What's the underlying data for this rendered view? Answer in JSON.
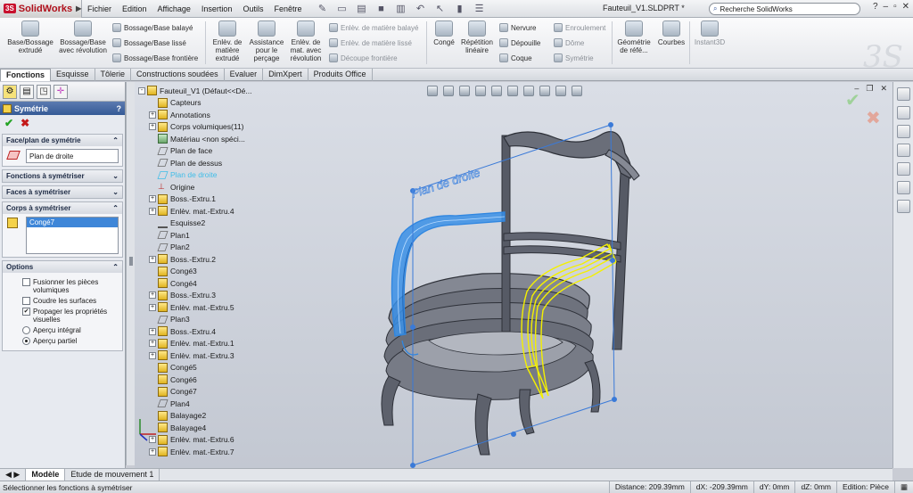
{
  "app": {
    "logo_prefix": "3S",
    "logo_name": "SolidWorks",
    "doc_title": "Fauteuil_V1.SLDPRT *",
    "search_placeholder": "Recherche SolidWorks"
  },
  "menu": [
    "Fichier",
    "Edition",
    "Affichage",
    "Insertion",
    "Outils",
    "Fenêtre"
  ],
  "ribbon": {
    "base_bossage": "Base/Bossage extrudé",
    "bossage_revolution": "Bossage/Base avec révolution",
    "bossage_balaye": "Bossage/Base balayé",
    "bossage_lisse": "Bossage/Base lissé",
    "bossage_frontiere": "Bossage/Base frontière",
    "enlev_extrude": "Enlèv. de matière extrudé",
    "assistance_percage": "Assistance pour le perçage",
    "enlev_revolution": "Enlèv. de mat. avec révolution",
    "enlev_balaye": "Enlèv. de matière balayé",
    "enlev_lisse": "Enlèv. de matière lissé",
    "decoupe_frontiere": "Découpe frontière",
    "conge": "Congé",
    "repetition": "Répétition linéaire",
    "nervure": "Nervure",
    "depouille": "Dépouille",
    "coque": "Coque",
    "enroulement": "Enroulement",
    "dome": "Dôme",
    "symetrie": "Symétrie",
    "geometrie": "Géométrie de réfé...",
    "courbes": "Courbes",
    "instant3d": "Instant3D"
  },
  "tabs": [
    "Fonctions",
    "Esquisse",
    "Tôlerie",
    "Constructions soudées",
    "Evaluer",
    "DimXpert",
    "Produits Office"
  ],
  "property_manager": {
    "title": "Symétrie",
    "help": "?",
    "sections": {
      "face_plan": "Face/plan de symétrie",
      "face_plan_value": "Plan de droite",
      "fonctions": "Fonctions à symétriser",
      "faces": "Faces à symétriser",
      "corps": "Corps à symétriser",
      "corps_value": "Congé7",
      "options": "Options"
    },
    "options": {
      "fusionner": "Fusionner les pièces volumiques",
      "coudre": "Coudre les surfaces",
      "propager": "Propager les propriétés visuelles",
      "apercu_integral": "Aperçu intégral",
      "apercu_partiel": "Aperçu partiel"
    }
  },
  "tree": [
    {
      "label": "Fauteuil_V1  (Défaut<<Dé...",
      "expand": "-",
      "icon": "part"
    },
    {
      "label": "Capteurs",
      "expand": "",
      "icon": "folder"
    },
    {
      "label": "Annotations",
      "expand": "+",
      "icon": "annot"
    },
    {
      "label": "Corps volumiques(11)",
      "expand": "+",
      "icon": "folder"
    },
    {
      "label": "Matériau <non spéci...",
      "expand": "",
      "icon": "material"
    },
    {
      "label": "Plan de face",
      "expand": "",
      "icon": "plane"
    },
    {
      "label": "Plan de dessus",
      "expand": "",
      "icon": "plane"
    },
    {
      "label": "Plan de droite",
      "expand": "",
      "icon": "plane",
      "highlight": true
    },
    {
      "label": "Origine",
      "expand": "",
      "icon": "origin"
    },
    {
      "label": "Boss.-Extru.1",
      "expand": "+",
      "icon": "feature"
    },
    {
      "label": "Enlèv. mat.-Extru.4",
      "expand": "+",
      "icon": "feature"
    },
    {
      "label": "Esquisse2",
      "expand": "",
      "icon": "sketch"
    },
    {
      "label": "Plan1",
      "expand": "",
      "icon": "plane"
    },
    {
      "label": "Plan2",
      "expand": "",
      "icon": "plane"
    },
    {
      "label": "Boss.-Extru.2",
      "expand": "+",
      "icon": "feature"
    },
    {
      "label": "Congé3",
      "expand": "",
      "icon": "feature"
    },
    {
      "label": "Congé4",
      "expand": "",
      "icon": "feature"
    },
    {
      "label": "Boss.-Extru.3",
      "expand": "+",
      "icon": "feature"
    },
    {
      "label": "Enlèv. mat.-Extru.5",
      "expand": "+",
      "icon": "feature"
    },
    {
      "label": "Plan3",
      "expand": "",
      "icon": "plane"
    },
    {
      "label": "Boss.-Extru.4",
      "expand": "+",
      "icon": "feature"
    },
    {
      "label": "Enlèv. mat.-Extru.1",
      "expand": "+",
      "icon": "feature"
    },
    {
      "label": "Enlèv. mat.-Extru.3",
      "expand": "+",
      "icon": "feature"
    },
    {
      "label": "Congé5",
      "expand": "",
      "icon": "feature"
    },
    {
      "label": "Congé6",
      "expand": "",
      "icon": "feature"
    },
    {
      "label": "Congé7",
      "expand": "",
      "icon": "feature"
    },
    {
      "label": "Plan4",
      "expand": "",
      "icon": "plane"
    },
    {
      "label": "Balayage2",
      "expand": "",
      "icon": "feature"
    },
    {
      "label": "Balayage4",
      "expand": "",
      "icon": "feature"
    },
    {
      "label": "Enlèv. mat.-Extru.6",
      "expand": "+",
      "icon": "feature"
    },
    {
      "label": "Enlèv. mat.-Extru.7",
      "expand": "+",
      "icon": "feature"
    }
  ],
  "viewport": {
    "plane_label": "Plan de droite"
  },
  "bottom_tabs": [
    "Modèle",
    "Etude de mouvement 1"
  ],
  "status": {
    "message": "Sélectionner les fonctions à symétriser",
    "distance": "Distance: 209.39mm",
    "dx": "dX: -209.39mm",
    "dy": "dY: 0mm",
    "dz": "dZ: 0mm",
    "edition": "Edition: Pièce"
  },
  "colors": {
    "accent": "#355a96",
    "selection_blue": "#2f86e0",
    "preview_yellow": "#f4f000",
    "plane_blue": "#3a7ad8"
  }
}
